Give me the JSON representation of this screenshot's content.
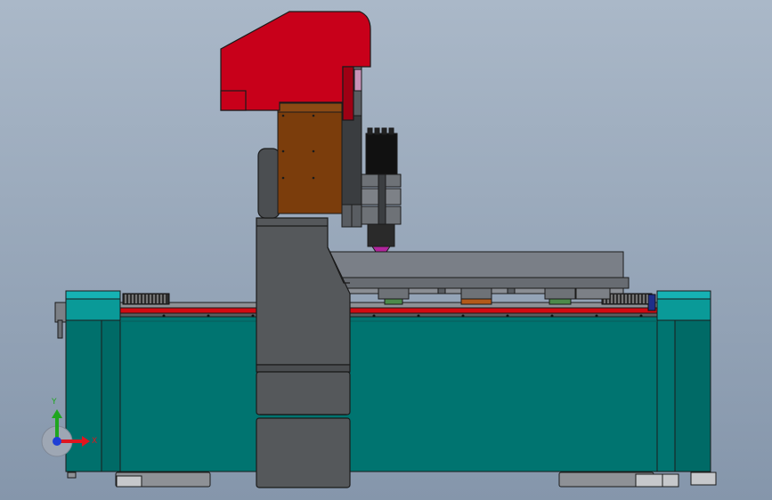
{
  "viewport": {
    "background_top": "#aab8c8",
    "background_bottom": "#8596ab"
  },
  "colors": {
    "frame_teal": "#007470",
    "frame_teal_light": "#0a9a98",
    "cap_cyan": "#16b2b4",
    "head_red": "#c8001a",
    "rail_red": "#d10a12",
    "carriage_brown": "#7b3d0c",
    "column_gray": "#55585b",
    "table_gray": "#7a7f87",
    "spindle_black": "#111111",
    "tool_tip_purple": "#b0259b",
    "edge": "#1b1b1b"
  },
  "triad": {
    "x_label": "X",
    "y_label": "Y",
    "x_color": "#e0161f",
    "y_color": "#1fa61f",
    "z_color": "#1f3fd6"
  }
}
